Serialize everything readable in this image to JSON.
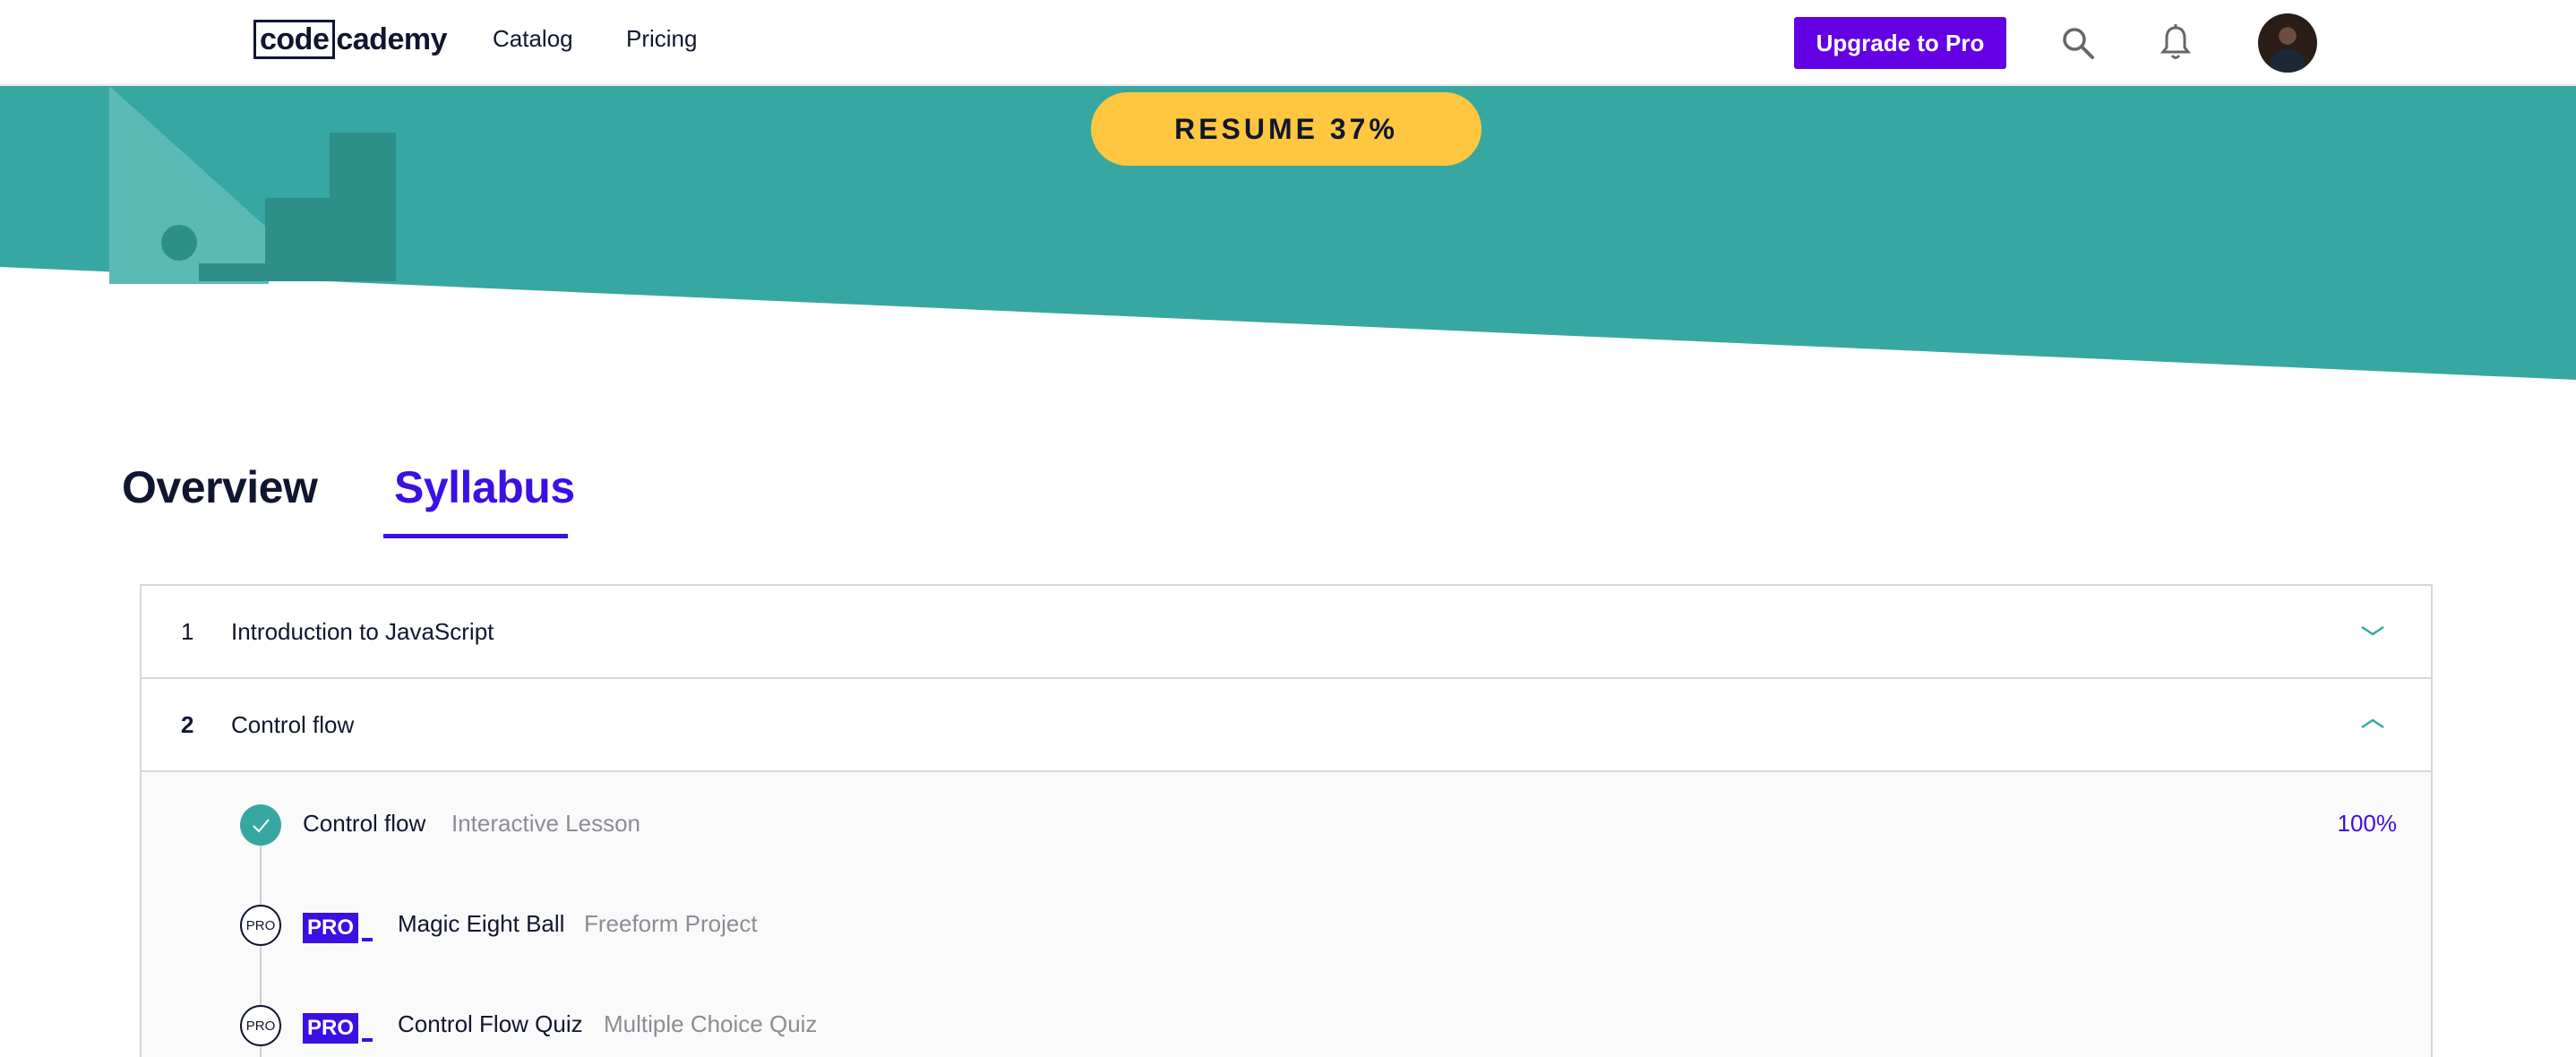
{
  "header": {
    "logo_boxed": "code",
    "logo_rest": "cademy",
    "nav": [
      {
        "label": "Catalog"
      },
      {
        "label": "Pricing"
      }
    ],
    "upgrade_label": "Upgrade to Pro",
    "icons": {
      "search": "search-icon",
      "notifications": "bell-icon"
    }
  },
  "hero": {
    "resume_label": "RESUME 37%",
    "colors": {
      "background": "#37a8a1",
      "button": "#ffc740"
    }
  },
  "tabs": [
    {
      "label": "Overview",
      "active": false
    },
    {
      "label": "Syllabus",
      "active": true
    }
  ],
  "syllabus": {
    "modules": [
      {
        "number": "1",
        "title": "Introduction to JavaScript",
        "expanded": false
      },
      {
        "number": "2",
        "title": "Control flow",
        "expanded": true
      }
    ],
    "lessons": [
      {
        "name": "Control flow",
        "type": "Interactive Lesson",
        "status": "completed",
        "progress": "100%"
      },
      {
        "name": "Magic Eight Ball",
        "type": "Freeform Project",
        "status": "pro",
        "badge": "PRO",
        "circle_label": "PRO"
      },
      {
        "name": "Control Flow Quiz",
        "type": "Multiple Choice Quiz",
        "status": "pro",
        "badge": "PRO",
        "circle_label": "PRO"
      }
    ]
  },
  "colors": {
    "accent": "#3a10e5",
    "upgrade": "#6400e4",
    "teal": "#37a8a1",
    "text": "#10162f"
  }
}
